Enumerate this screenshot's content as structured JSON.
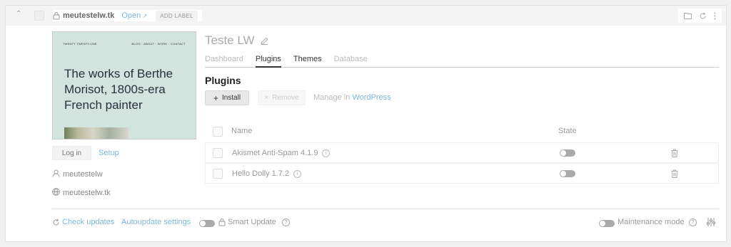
{
  "header": {
    "site_name": "meutestelw.tk",
    "open_label": "Open",
    "add_label": "ADD LABEL"
  },
  "preview": {
    "site_title": "TWENTY TWENTY-ONE",
    "menu": "BLOG · ABOUT · WORK · CONTACT",
    "headline": "The works of Berthe Morisot, 1800s-era French painter"
  },
  "left": {
    "login_label": "Log in",
    "setup_label": "Setup",
    "user": "meutestelw",
    "domain": "meutestelw.tk"
  },
  "main": {
    "title": "Teste LW",
    "tabs": [
      {
        "label": "Dashboard"
      },
      {
        "label": "Plugins"
      },
      {
        "label": "Themes"
      },
      {
        "label": "Database"
      }
    ],
    "section_title": "Plugins",
    "install_label": "Install",
    "remove_label": "Remove",
    "manage_prefix": "Manage in ",
    "manage_link": "WordPress",
    "columns": {
      "name": "Name",
      "state": "State"
    },
    "plugins": [
      {
        "name": "Akismet Anti-Spam 4.1.9"
      },
      {
        "name": "Hello Dolly 1.7.2"
      }
    ]
  },
  "footer": {
    "check_updates": "Check updates",
    "autoupdate_settings": "Autoupdate settings",
    "smart_update": "Smart Update",
    "maintenance_mode": "Maintenance mode"
  },
  "colors": {
    "accent": "#7ab8de",
    "preview_bg": "#d1e4dd"
  }
}
